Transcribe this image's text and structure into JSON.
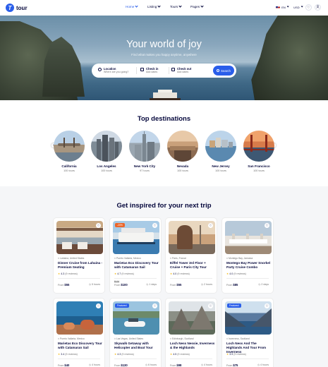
{
  "header": {
    "logo_text": "tour",
    "nav": [
      {
        "label": "Home",
        "active": true
      },
      {
        "label": "Listing",
        "active": false
      },
      {
        "label": "Tours",
        "active": false
      },
      {
        "label": "Pages",
        "active": false
      }
    ],
    "language": "EN",
    "currency": "USD"
  },
  "hero": {
    "title": "Your world of joy",
    "subtitle": "Find what makes you happy anytime, anywhere",
    "search": {
      "location_label": "Location",
      "location_placeholder": "Where are you going?",
      "checkin_label": "Check in",
      "checkin_placeholder": "Add dates",
      "checkout_label": "Check out",
      "checkout_placeholder": "Add dates",
      "button_label": "Search"
    }
  },
  "destinations": {
    "title": "Top destinations",
    "items": [
      {
        "name": "California",
        "count": "100 tours"
      },
      {
        "name": "Los Angeles",
        "count": "100 tours"
      },
      {
        "name": "New York City",
        "count": "97 tours"
      },
      {
        "name": "Nevada",
        "count": "100 tours"
      },
      {
        "name": "New Jersey",
        "count": "100 tours"
      },
      {
        "name": "San Francisco",
        "count": "100 tours"
      }
    ]
  },
  "inspired": {
    "title": "Get inspired for your next trip",
    "cards": [
      {
        "location": "Lahaina, United States",
        "title": "Dinner Cruise from Lahaina - Premium Seating",
        "rating": "4.3",
        "reviews": "(9 reviews)",
        "price_label": "From",
        "price": "$55",
        "old_price": "",
        "duration": "5 hours",
        "badge": "",
        "badge_color": ""
      },
      {
        "location": "Puerto Vallarta, Mexico",
        "title": "Marietas Eco Discovery Tour with Catamaran Sail",
        "rating": "4.7",
        "reviews": "(9 reviews)",
        "price_label": "From",
        "price": "$100",
        "old_price": "$120",
        "duration": "1 days",
        "badge": "-20%",
        "badge_color": "#eb662b"
      },
      {
        "location": "Paris, France",
        "title": "Eiffel Tower 3rd Floor + Cruise + Paris City Tour",
        "rating": "4.0",
        "reviews": "(9 reviews)",
        "price_label": "From",
        "price": "$55",
        "old_price": "",
        "duration": "2 hours",
        "badge": "",
        "badge_color": ""
      },
      {
        "location": "Montego Bay, Jamaica",
        "title": "Montego Bay Power Snorkel Party Cruise Combo",
        "rating": "4.0",
        "reviews": "(9 reviews)",
        "price_label": "From",
        "price": "$85",
        "old_price": "",
        "duration": "2 days",
        "badge": "",
        "badge_color": ""
      },
      {
        "location": "Puerto Vallarta, Mexico",
        "title": "Marietas Eco Discovery Tour with Catamaran Sail",
        "rating": "3.4",
        "reviews": "(9 reviews)",
        "price_label": "From",
        "price": "$40",
        "old_price": "",
        "duration": "4 hours",
        "badge": "",
        "badge_color": ""
      },
      {
        "location": "Las Vegas, United States",
        "title": "Skywalk Getaway with Helicopter and Boat Tour",
        "rating": "4.3",
        "reviews": "(9 reviews)",
        "price_label": "From",
        "price": "$130",
        "old_price": "",
        "duration": "6 hours",
        "badge": "Featured",
        "badge_color": "#2a5eea"
      },
      {
        "location": "Edinburgh, Scotland",
        "title": "Loch Ness Nessie, Inverness & the Highlands",
        "rating": "4.5",
        "reviews": "(9 reviews)",
        "price_label": "From",
        "price": "$98",
        "old_price": "",
        "duration": "4 hours",
        "badge": "",
        "badge_color": ""
      },
      {
        "location": "Inverness, Scotland",
        "title": "Loch Ness And The Highlands And Tour From Inverness",
        "rating": "3.9",
        "reviews": "(9 reviews)",
        "price_label": "From",
        "price": "$75",
        "old_price": "",
        "duration": "4 hours",
        "badge": "Featured",
        "badge_color": "#2a5eea"
      }
    ]
  },
  "colors": {
    "accent": "#2a5eea",
    "text": "#05073c",
    "sale": "#eb662b",
    "star": "#f4b400"
  }
}
